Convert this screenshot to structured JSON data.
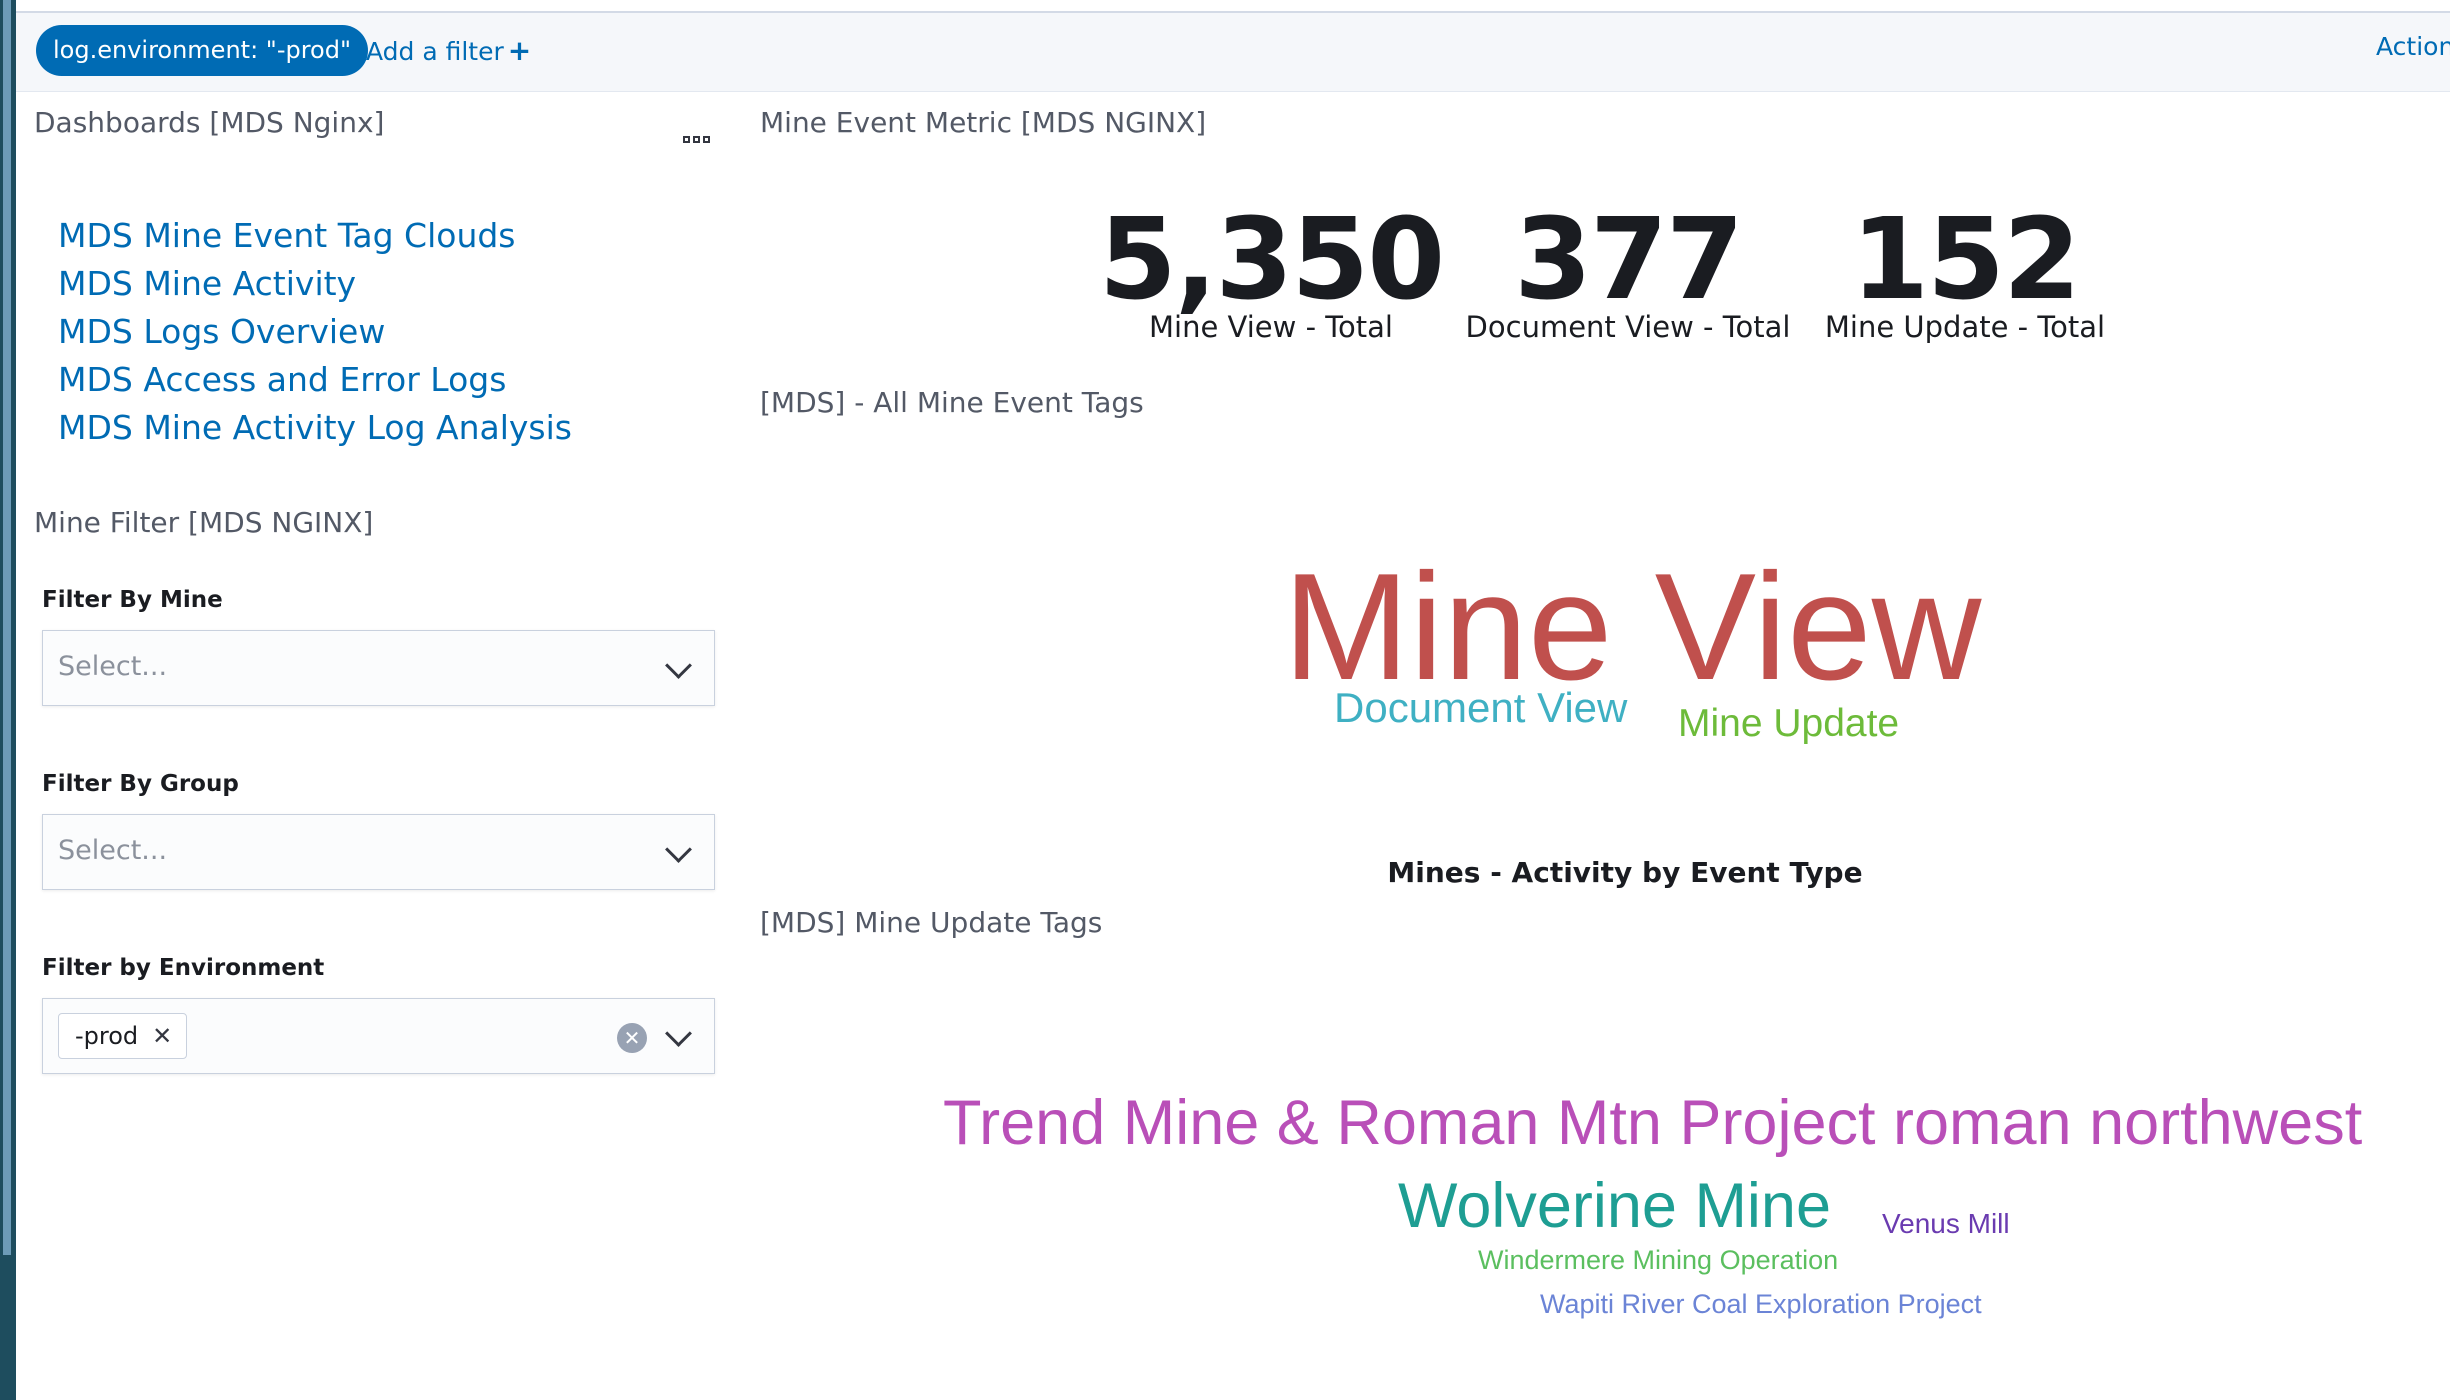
{
  "filter_bar": {
    "filter_pill": "log.environment: \"-prod\"",
    "add_filter_label": "Add a filter",
    "add_filter_icon": "+",
    "actions_label": "Action"
  },
  "dashboards_panel": {
    "title": "Dashboards [MDS Nginx]",
    "menu_icon": "ooo",
    "links": [
      "MDS Mine Event Tag Clouds",
      "MDS Mine Activity",
      "MDS Logs Overview",
      "MDS Access and Error Logs",
      "MDS Mine Activity Log Analysis"
    ]
  },
  "mine_filter_panel": {
    "title": "Mine Filter [MDS NGINX]",
    "filters": [
      {
        "label": "Filter By Mine",
        "placeholder": "Select..."
      },
      {
        "label": "Filter By Group",
        "placeholder": "Select..."
      },
      {
        "label": "Filter by Environment",
        "selected_chip": "-prod"
      }
    ]
  },
  "metric_panel": {
    "title": "Mine Event Metric [MDS NGINX]",
    "metrics": [
      {
        "value": "5,350",
        "label": "Mine View - Total"
      },
      {
        "value": "377",
        "label": "Document View - Total"
      },
      {
        "value": "152",
        "label": "Mine Update - Total"
      }
    ]
  },
  "event_tags_panel": {
    "title": "[MDS] - All Mine Event Tags",
    "tags": [
      {
        "text": "Mine View",
        "color": "#c0504d"
      },
      {
        "text": "Document View",
        "color": "#3fb0c3"
      },
      {
        "text": "Mine Update",
        "color": "#6dbb3a"
      }
    ]
  },
  "activity_chart": {
    "title": "Mines - Activity by Event Type"
  },
  "update_tags_panel": {
    "title": "[MDS] Mine Update Tags",
    "tags": [
      {
        "text": "Trend Mine & Roman Mtn Project roman northwest",
        "color": "#b94fb8"
      },
      {
        "text": "Wolverine Mine",
        "color": "#1e9e93"
      },
      {
        "text": "Venus Mill",
        "color": "#6a3bb0"
      },
      {
        "text": "Windermere Mining Operation",
        "color": "#5bbf5f"
      },
      {
        "text": "Wapiti River Coal Exploration Project",
        "color": "#6b84d6"
      }
    ]
  }
}
